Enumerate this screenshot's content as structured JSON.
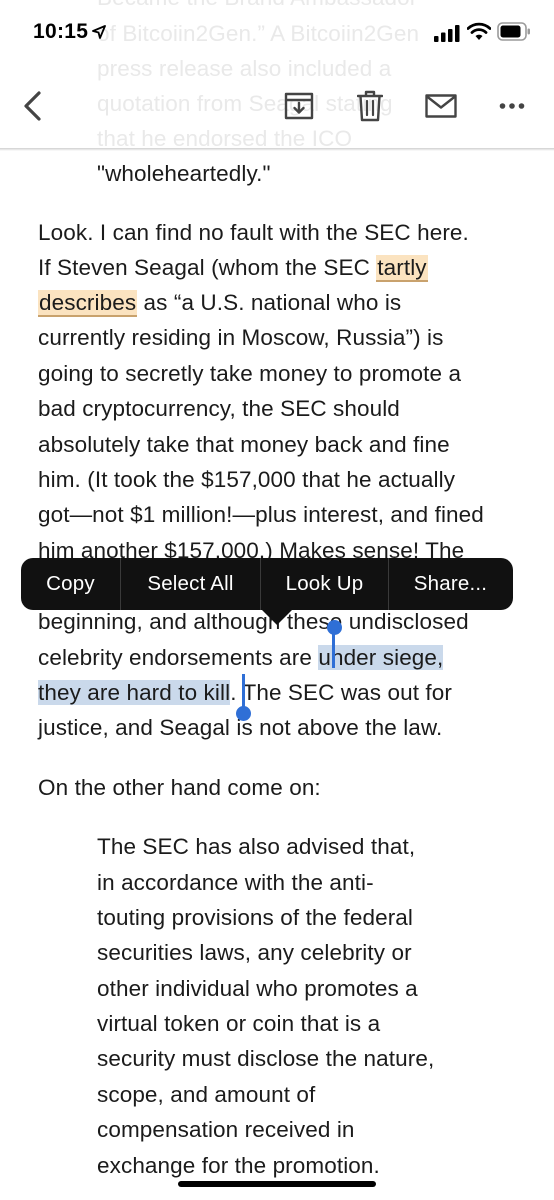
{
  "status": {
    "time": "10:15"
  },
  "icons": {
    "location": "location-arrow-icon",
    "signal": "cellular-signal-icon",
    "wifi": "wifi-icon",
    "battery": "battery-icon",
    "back": "chevron-left-icon",
    "archive": "archive-icon",
    "trash": "trash-icon",
    "mail": "mail-icon",
    "more": "more-icon"
  },
  "article": {
    "quote1": [
      "Became the Brand Ambassador",
      "of Bitcoiin2Gen.” A Bitcoiin2Gen",
      "press release also included a",
      "quotation from Seagal stating",
      "that he endorsed the ICO",
      "\"wholeheartedly.\""
    ],
    "para1": {
      "l1": "Look. I can find no fault with the SEC here.",
      "l2_pre": "If Steven Seagal (whom the SEC ",
      "l2_hl": "tartly",
      "l3_hl": "describes",
      "l3_post": " as “a U.S. national who is",
      "l4": "currently residing in Moscow, Russia”) is",
      "l5": "going to secretly take money to promote a",
      "l6": "bad cryptocurrency, the SEC should",
      "l7": "absolutely take that money back and fine",
      "l8": "him. (It took the $157,000 that he actually",
      "l9": "got—not $1 million!—plus interest, and fined",
      "l10": "him another $157,000.) Makes sense! The",
      "l11": "beginning, and although these undisclosed",
      "l12_pre": "celebrity endorsements are ",
      "l12_sel": "under siege,",
      "l13_sel": "they are hard to kill",
      "l13_post": ". The SEC was out for",
      "l14": "justice, and Seagal is not above the law."
    },
    "para2": "On the other hand come on:",
    "quote2": [
      "The SEC has also advised that,",
      "in accordance with the anti-",
      "touting provisions of the federal",
      "securities laws, any celebrity or",
      "other individual who promotes a",
      "virtual token or coin that is a",
      "security must disclose the nature,",
      "scope, and amount of",
      "compensation received in",
      "exchange for the promotion."
    ]
  },
  "menu": {
    "copy": "Copy",
    "select_all": "Select All",
    "look_up": "Look Up",
    "share": "Share..."
  },
  "colors": {
    "highlight": "#fbe3c0",
    "selection": "#cad9eb",
    "handle": "#2f6fd6",
    "menu_bg": "#111111"
  }
}
